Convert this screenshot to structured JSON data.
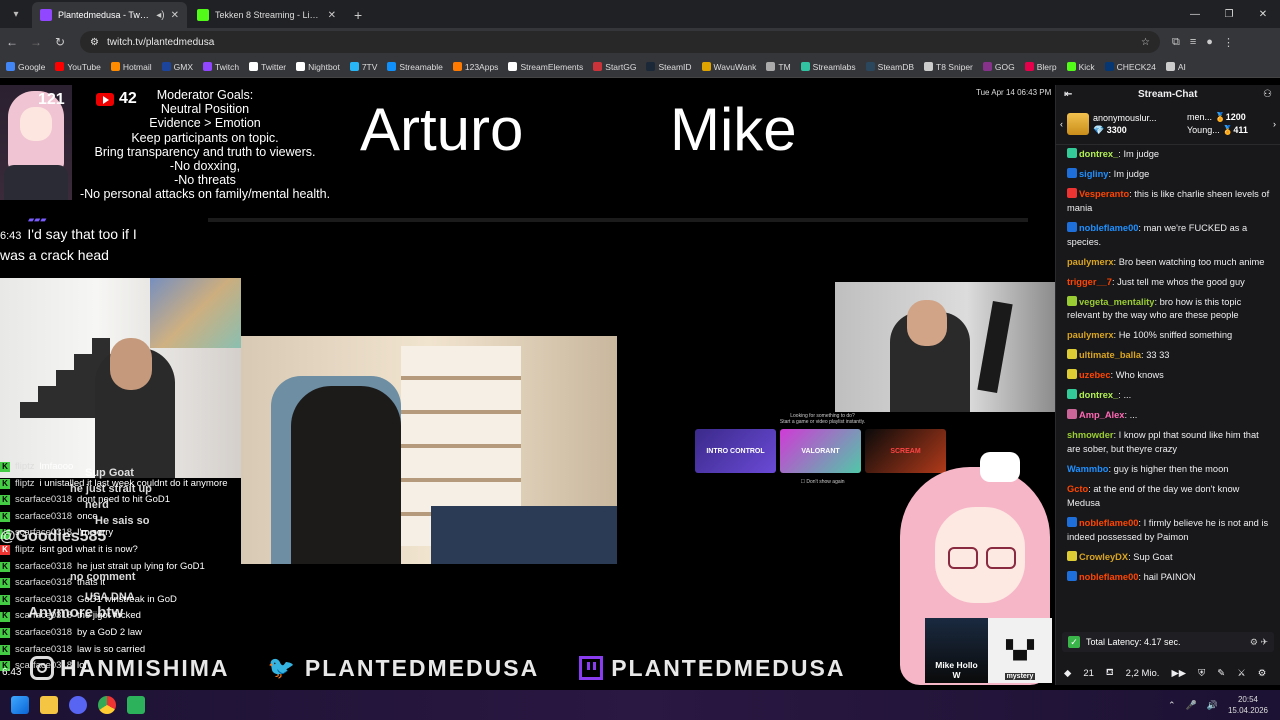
{
  "browser": {
    "tabs": [
      {
        "title": "Plantedmedusa - Twitch",
        "active": true,
        "favicon_color": "#9146ff"
      },
      {
        "title": "Tekken 8 Streaming - Live Strea",
        "active": false,
        "favicon_color": "#53fc18"
      }
    ],
    "url": "twitch.tv/plantedmedusa",
    "bookmarks": [
      {
        "label": "Google",
        "color": "#4285f4"
      },
      {
        "label": "YouTube",
        "color": "#ff0000"
      },
      {
        "label": "Hotmail",
        "color": "#ff8c00"
      },
      {
        "label": "GMX",
        "color": "#1c449b"
      },
      {
        "label": "Twitch",
        "color": "#9146ff"
      },
      {
        "label": "Twitter",
        "color": "#ffffff"
      },
      {
        "label": "Nightbot",
        "color": "#ffffff"
      },
      {
        "label": "7TV",
        "color": "#29b6f6"
      },
      {
        "label": "Streamable",
        "color": "#0f90fa"
      },
      {
        "label": "123Apps",
        "color": "#ff7a00"
      },
      {
        "label": "StreamElements",
        "color": "#ffffff"
      },
      {
        "label": "StartGG",
        "color": "#cb333b"
      },
      {
        "label": "SteamID",
        "color": "#1b2838"
      },
      {
        "label": "WavuWank",
        "color": "#e0a400"
      },
      {
        "label": "TM",
        "color": "#aaaaaa"
      },
      {
        "label": "Streamlabs",
        "color": "#31c3a2"
      },
      {
        "label": "SteamDB",
        "color": "#2a475e"
      },
      {
        "label": "T8 Sniper",
        "color": "#cccccc"
      },
      {
        "label": "GOG",
        "color": "#86328a"
      },
      {
        "label": "Blerp",
        "color": "#e5004c"
      },
      {
        "label": "Kick",
        "color": "#53fc18"
      },
      {
        "label": "CHECK24",
        "color": "#063773"
      },
      {
        "label": "AI",
        "color": "#cccccc"
      }
    ]
  },
  "stream": {
    "viewer_count": "121",
    "youtube_count": "42",
    "goals": [
      "Moderator Goals:",
      "Neutral Position",
      "Evidence > Emotion",
      "Keep participants on topic.",
      "Bring transparency and truth to viewers.",
      "-No doxxing,",
      "-No threats",
      "-No personal attacks on family/mental health."
    ],
    "name_left": "Arturo",
    "name_right": "Mike",
    "datetime": "Tue Apr 14 06:43 PM",
    "overlay_caption_time": "6:43",
    "overlay_caption_line1": "I'd say that too if I",
    "overlay_caption_line2": "was a crack head",
    "suggest_title": "Looking for something to do?",
    "suggest_sub": "Start a game or video playlist instantly.",
    "suggest_thumbs": [
      "INTRO CONTROL",
      "VALORANT",
      "SCREAM"
    ],
    "suggest_check": "Don't show again",
    "mini_cam_label": "Mike Hollo",
    "mini_cam_sub": "W",
    "mini_logo_sub": "mystery",
    "overlay_chat": [
      {
        "user": "fliptz",
        "text": "lmfaooo",
        "color": "#4c4"
      },
      {
        "user": "fliptz",
        "text": "i unistalled it last week couldnt do it anymore",
        "color": "#4c4"
      },
      {
        "user": "scarface0318",
        "text": "dont need to hit GoD1",
        "color": "#4c4"
      },
      {
        "user": "scarface0318",
        "text": "once",
        "color": "#4c4"
      },
      {
        "user": "scarface0318",
        "text": "I'm sorry",
        "color": "#4c4"
      },
      {
        "user": "fliptz",
        "text": "isnt god what it is now?",
        "color": "#e33"
      },
      {
        "user": "scarface0318",
        "text": "he just strait up lying for GoD1",
        "color": "#4c4"
      },
      {
        "user": "scarface0318",
        "text": "thats it",
        "color": "#4c4"
      },
      {
        "user": "scarface0318",
        "text": "GoD1 winstreak in GoD",
        "color": "#4c4"
      },
      {
        "user": "scarface0318",
        "text": "the jigot fucked",
        "color": "#4c4"
      },
      {
        "user": "scarface0318",
        "text": "by a GoD 2 law",
        "color": "#4c4"
      },
      {
        "user": "scarface0318",
        "text": "law is so carried",
        "color": "#4c4"
      },
      {
        "user": "scarface0318",
        "text": "lol",
        "color": "#4c4"
      }
    ],
    "ghost_texts": [
      "Sup Goat",
      "he just strait up",
      "nerd",
      "He sais so",
      "@Goodies585",
      "no comment",
      "USA DNA",
      "Anymore btw"
    ],
    "socials": {
      "instagram": "HANMISHIMA",
      "twitter": "PLANTEDMEDUSA",
      "twitch": "PLANTEDMEDUSA"
    },
    "bottom_time": "6:43"
  },
  "chat": {
    "title": "Stream-Chat",
    "hype": {
      "user": "anonymouslur...",
      "amount": "3300",
      "user2": "men...",
      "amount2": "1200",
      "user3": "Young...",
      "amount3": "411"
    },
    "messages": [
      {
        "user": "dontrex_",
        "color": "#b2f051",
        "text": "Im judge",
        "badge": "#3c9"
      },
      {
        "user": "sigliny",
        "color": "#1e90ff",
        "text": "Im judge",
        "badge": "#1e6fd9"
      },
      {
        "user": "Vesperanto",
        "color": "#ff4500",
        "text": "this is like charlie sheen levels of mania",
        "badge": "#e33"
      },
      {
        "user": "nobleflame00",
        "color": "#1e90ff",
        "text": "man we're FUCKED as a species.",
        "badge": "#1e6fd9"
      },
      {
        "user": "paulymerx",
        "color": "#daa520",
        "text": "Bro been watching too much anime",
        "badge": ""
      },
      {
        "user": "trigger__7",
        "color": "#ff4500",
        "text": "Just tell me whos the good guy",
        "badge": ""
      },
      {
        "user": "vegeta_mentality",
        "color": "#9acd32",
        "text": "bro how is this topic relevant by the way who are these people",
        "badge": "#9c3"
      },
      {
        "user": "paulymerx",
        "color": "#daa520",
        "text": "He 100% sniffed something",
        "badge": ""
      },
      {
        "user": "ultimate_balla",
        "color": "#daa520",
        "text": "33 33",
        "badge": "#dc3"
      },
      {
        "user": "uzebec",
        "color": "#ff4500",
        "text": "Who knows",
        "badge": "#dc3"
      },
      {
        "user": "dontrex_",
        "color": "#b2f051",
        "text": "...",
        "badge": "#3c9"
      },
      {
        "user": "Amp_Alex",
        "color": "#ff69b4",
        "text": "...",
        "badge": "#c69"
      },
      {
        "user": "shmowder",
        "color": "#9acd32",
        "text": "I know ppl that sound like him that are sober, but theyre crazy",
        "badge": ""
      },
      {
        "user": "Wammbo",
        "color": "#1e90ff",
        "text": "guy is higher then the moon",
        "badge": ""
      },
      {
        "user": "Gcto",
        "color": "#ff4500",
        "text": "at the end of the day we don't know Medusa",
        "badge": ""
      },
      {
        "user": "nobleflame00",
        "color": "#ff4500",
        "text": "I firmly believe he is not and is indeed possessed by Paimon",
        "badge": "#1e6fd9"
      },
      {
        "user": "CrowleyDX",
        "color": "#daa520",
        "text": "Sup Goat",
        "badge": "#dc3"
      },
      {
        "user": "nobleflame00",
        "color": "#ff4500",
        "text": "hail PAINON",
        "badge": "#1e6fd9"
      }
    ],
    "latency": "Total Latency: 4.17 sec.",
    "footer_points": "21",
    "footer_mio": "2,2 Mio."
  },
  "taskbar": {
    "time": "20:54",
    "date": "15.04.2026"
  }
}
